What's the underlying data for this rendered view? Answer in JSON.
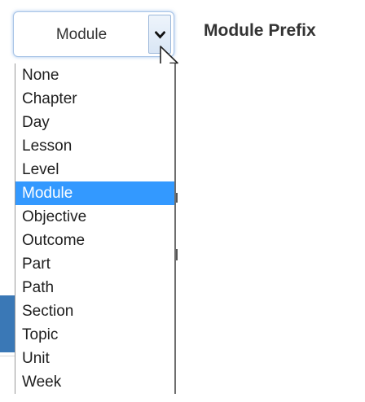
{
  "select": {
    "value": "Module",
    "arrow_icon": "chevron-down-icon",
    "options": [
      {
        "label": "None",
        "selected": false
      },
      {
        "label": "Chapter",
        "selected": false
      },
      {
        "label": "Day",
        "selected": false
      },
      {
        "label": "Lesson",
        "selected": false
      },
      {
        "label": "Level",
        "selected": false
      },
      {
        "label": "Module",
        "selected": true
      },
      {
        "label": "Objective",
        "selected": false
      },
      {
        "label": "Outcome",
        "selected": false
      },
      {
        "label": "Part",
        "selected": false
      },
      {
        "label": "Path",
        "selected": false
      },
      {
        "label": "Section",
        "selected": false
      },
      {
        "label": "Topic",
        "selected": false
      },
      {
        "label": "Unit",
        "selected": false
      },
      {
        "label": "Week",
        "selected": false
      }
    ]
  },
  "heading": {
    "title": "Module Prefix"
  },
  "colors": {
    "highlight": "#3399ff",
    "focus_glow": "#a8c4e6",
    "text": "#333333"
  }
}
